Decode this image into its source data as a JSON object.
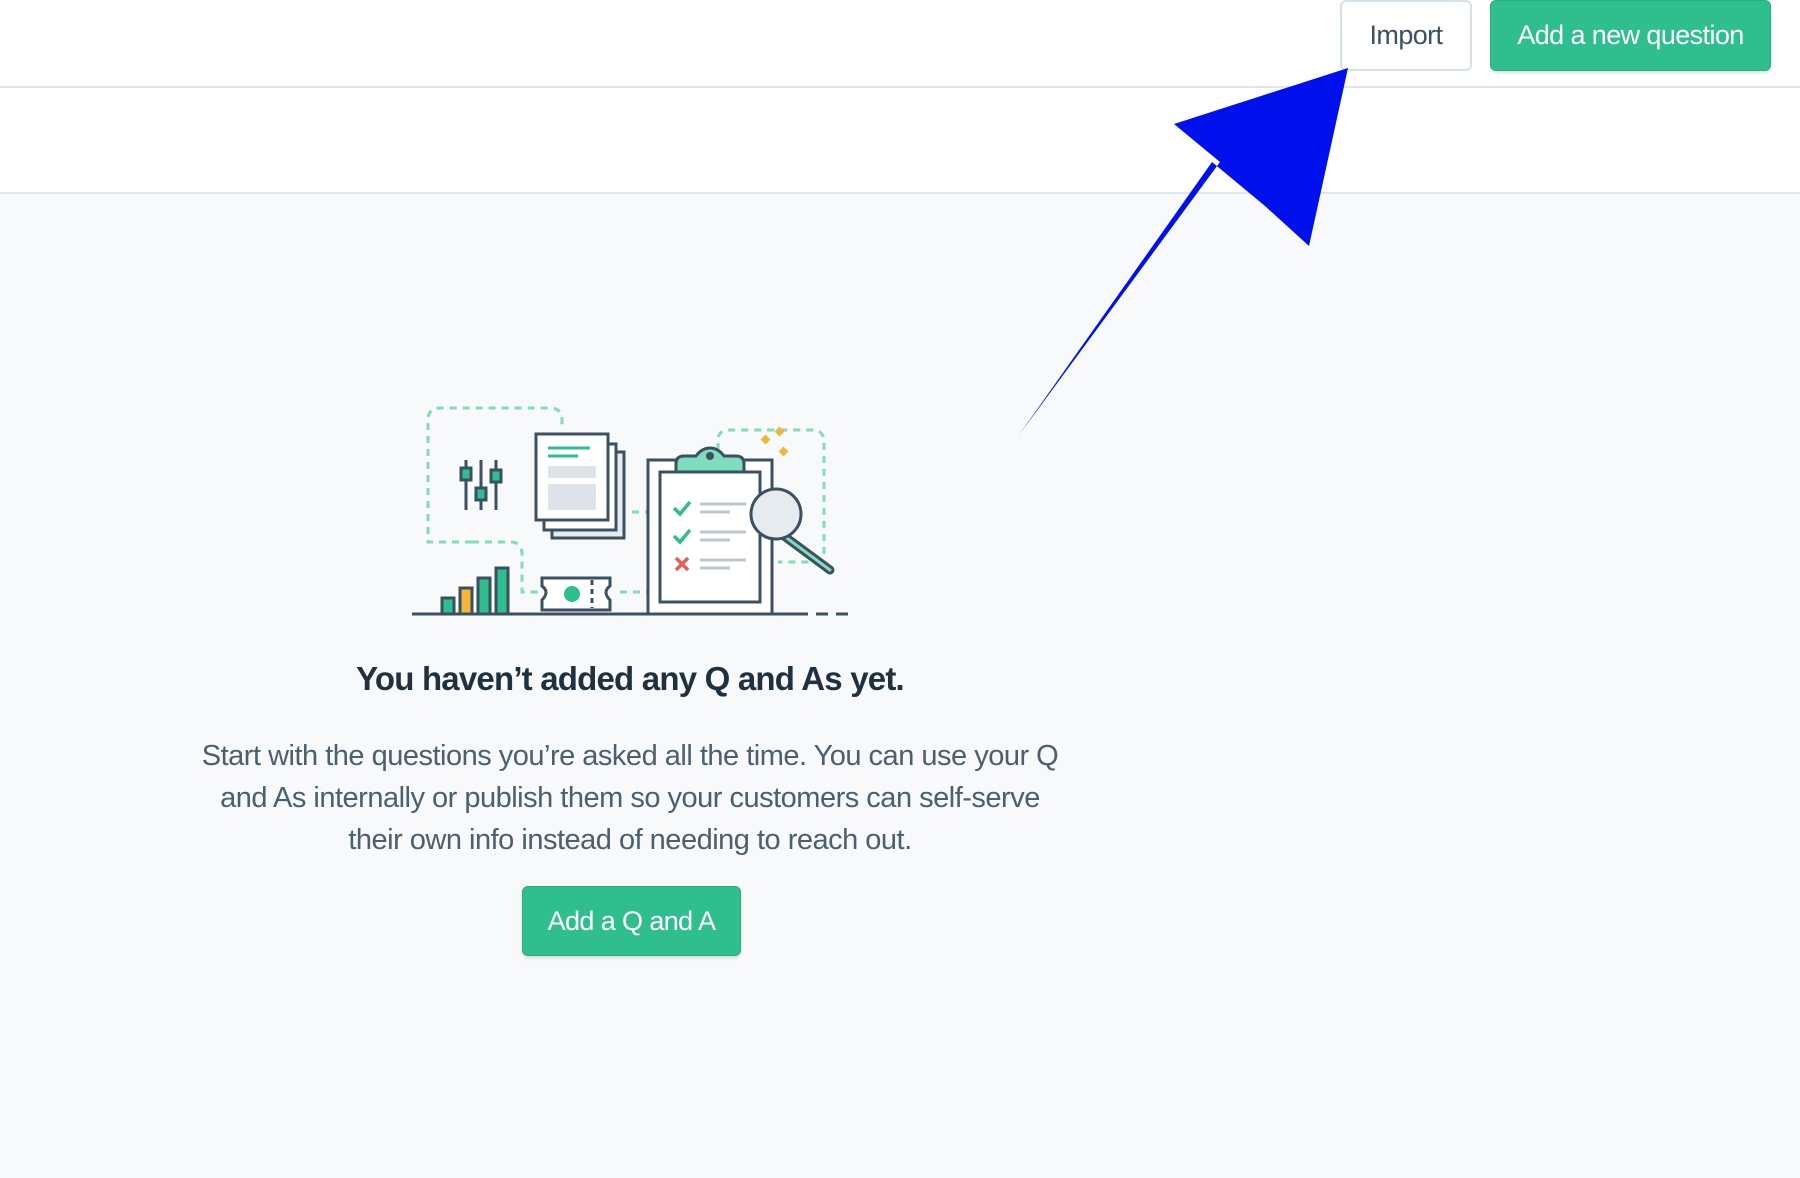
{
  "toolbar": {
    "import_label": "Import",
    "add_question_label": "Add a new question"
  },
  "empty_state": {
    "title": "You haven’t added any Q and As yet.",
    "description": "Start with the questions you’re asked all the time. You can use your Q and As internally or publish them so your customers can self-serve their own info instead of needing to reach out.",
    "cta_label": "Add a Q and A"
  },
  "colors": {
    "accent": "#2fbf8f",
    "annotation_arrow": "#0011ee",
    "background": "#f7f9fa"
  }
}
